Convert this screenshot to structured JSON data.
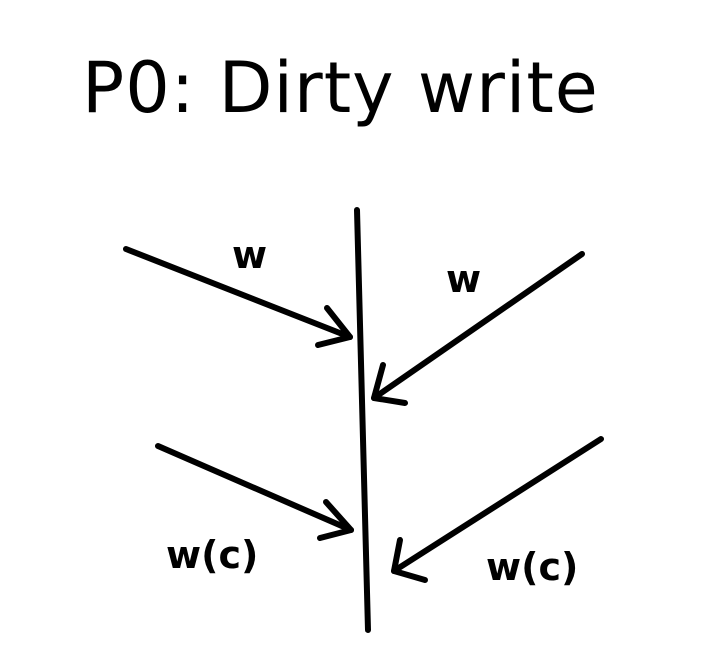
{
  "title": "P0: Dirty write",
  "labels": {
    "top_left": "w",
    "top_right": "w",
    "bottom_left": "w(c)",
    "bottom_right": "w(c)"
  },
  "colors": {
    "ink": "#000000",
    "background": "#ffffff"
  }
}
